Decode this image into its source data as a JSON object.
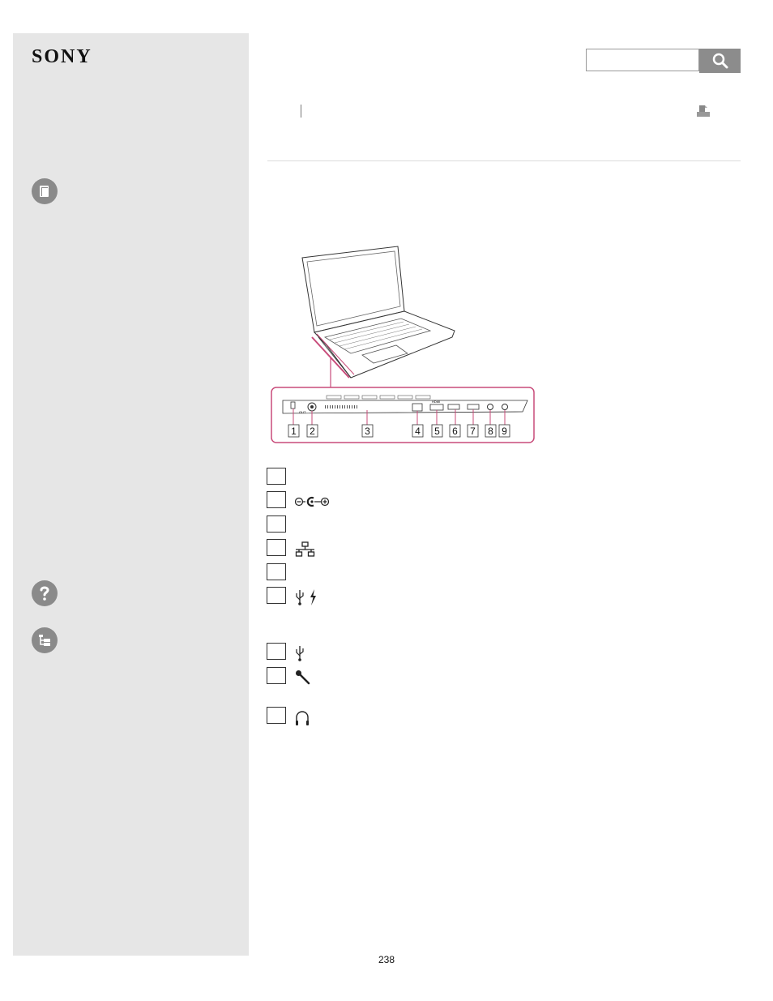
{
  "brand": {
    "logo_text": "SONY"
  },
  "search": {
    "placeholder": "",
    "button_icon": "search-icon"
  },
  "sidebar": {
    "icons": [
      "book-icon",
      "help-icon",
      "tree-icon"
    ]
  },
  "figure": {
    "callout_labels": [
      "1",
      "2",
      "3",
      "4",
      "5",
      "6",
      "7",
      "8",
      "9"
    ],
    "hdmi_mark": "HDMI",
    "out_mark": "OUT"
  },
  "items": [
    {
      "icon": ""
    },
    {
      "icon": "dc-in-icon"
    },
    {
      "icon": ""
    },
    {
      "icon": "network-icon"
    },
    {
      "icon": ""
    },
    {
      "icon": "usb-charge-icon"
    },
    {
      "icon": "usb-icon"
    },
    {
      "icon": "microphone-icon"
    },
    {
      "icon": "headphones-icon"
    }
  ],
  "footer": {
    "page_number": "238"
  }
}
